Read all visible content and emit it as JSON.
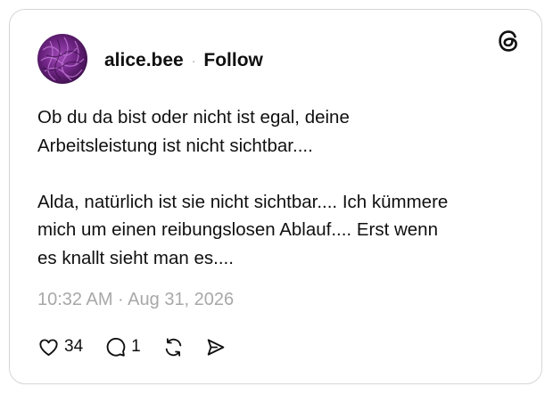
{
  "post": {
    "username": "alice.bee",
    "separator": "·",
    "follow_label": "Follow",
    "paragraphs": [
      [
        "Ob du da bist oder nicht ist egal, deine",
        "Arbeitsleistung ist nicht sichtbar...."
      ],
      [
        "Alda, natürlich ist sie nicht sichtbar.... Ich kümmere",
        "mich um einen reibungslosen Ablauf.... Erst wenn",
        "es knallt sieht man es...."
      ]
    ],
    "timestamp": "10:32 AM · Aug 31, 2026"
  },
  "actions": {
    "like_count": "34",
    "reply_count": "1"
  },
  "icons": {
    "brand": "threads-logo-icon",
    "like": "heart-icon",
    "reply": "comment-bubble-icon",
    "repost": "repost-icon",
    "share": "send-icon"
  },
  "colors": {
    "text": "#101010",
    "muted": "#a8a8a8",
    "border": "#d6d6d6",
    "avatar": "#7b2d8e"
  }
}
